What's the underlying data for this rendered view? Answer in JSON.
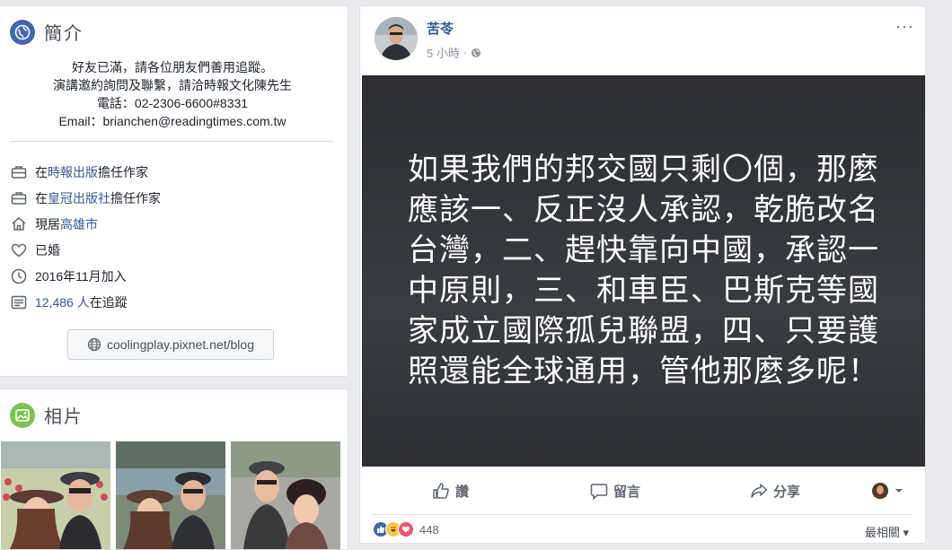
{
  "intro": {
    "title": "簡介",
    "bio_lines": [
      "好友已滿，請各位朋友們善用追蹤。",
      "演講邀約詢問及聯繫，請洽時報文化陳先生",
      "電話：02-2306-6600#8331",
      "Email：brianchen@readingtimes.com.tw"
    ],
    "items": [
      {
        "icon": "briefcase-icon",
        "pre": "在",
        "link": "時報出版",
        "post": "擔任作家"
      },
      {
        "icon": "briefcase-icon",
        "pre": "在",
        "link": "皇冠出版社",
        "post": "擔任作家"
      },
      {
        "icon": "house-icon",
        "pre": "現居",
        "link": "高雄市",
        "post": ""
      },
      {
        "icon": "heart-icon",
        "pre": "已婚",
        "link": "",
        "post": ""
      },
      {
        "icon": "clock-icon",
        "pre": "2016年11月加入",
        "link": "",
        "post": ""
      },
      {
        "icon": "rss-icon",
        "pre": "",
        "link": "12,486 人",
        "post": "在追蹤"
      }
    ],
    "website": "coolingplay.pixnet.net/blog"
  },
  "photos": {
    "title": "相片"
  },
  "post": {
    "author": "苦苓",
    "time": "5 小時",
    "separator": "·",
    "text": "如果我們的邦交國只剩〇個，那麼應該一、反正沒人承認，乾脆改名台灣，二、趕快靠向中國，承認一中原則，三、和車臣、巴斯克等國家成立國際孤兒聯盟，四、只要護照還能全球通用，管他那麼多呢！",
    "more": "···",
    "actions": {
      "like": "讚",
      "comment": "留言",
      "share": "分享"
    },
    "reaction_count": "448",
    "sort_label": "最相關 ▾"
  },
  "colors": {
    "link": "#365899",
    "page_bg": "#e9ebee",
    "post_bg": "#2f3137"
  }
}
